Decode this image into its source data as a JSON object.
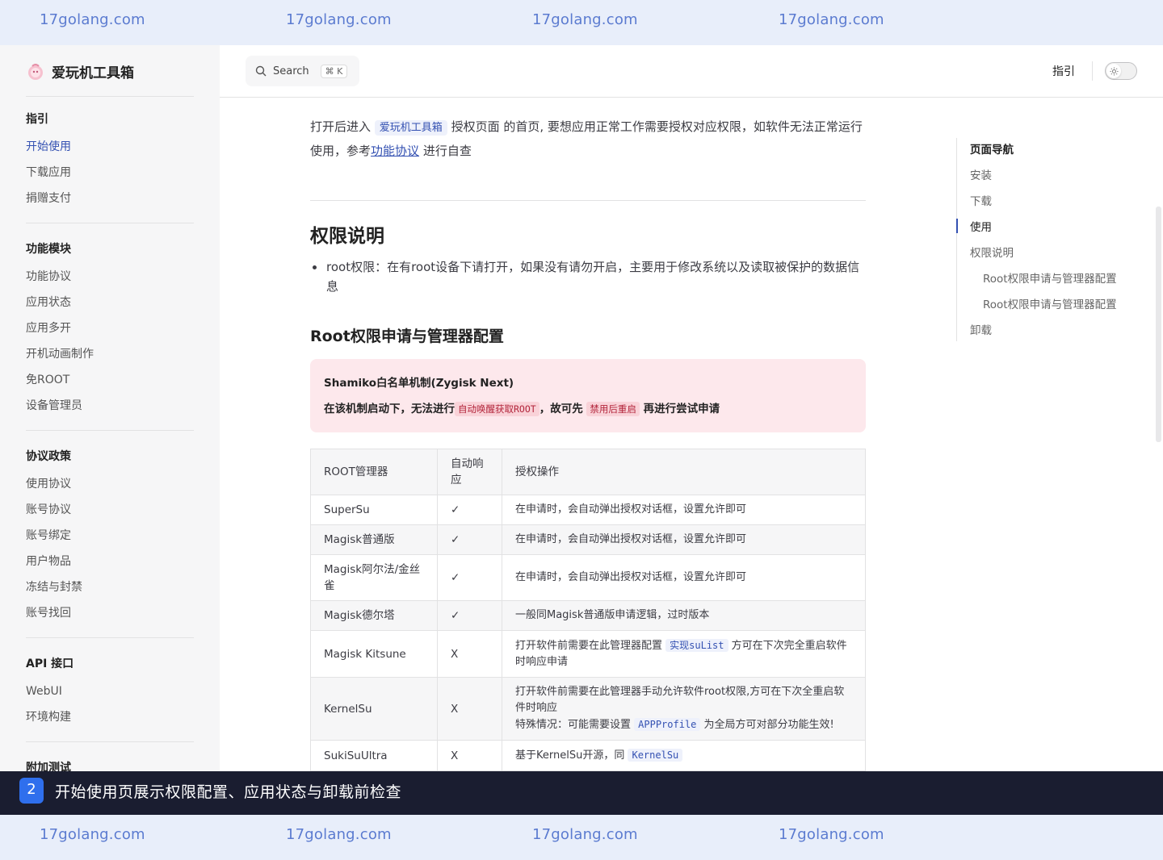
{
  "watermark": {
    "text": "17golang.com",
    "color": "#5b7bd0"
  },
  "sidebar": {
    "brand": "爱玩机工具箱",
    "groups": [
      {
        "title": "指引",
        "items": [
          "开始使用",
          "下载应用",
          "捐赠支付"
        ]
      },
      {
        "title": "功能模块",
        "items": [
          "功能协议",
          "应用状态",
          "应用多开",
          "开机动画制作",
          "免ROOT",
          "设备管理员"
        ]
      },
      {
        "title": "协议政策",
        "items": [
          "使用协议",
          "账号协议",
          "账号绑定",
          "用户物品",
          "冻结与封禁",
          "账号找回"
        ]
      },
      {
        "title": "API 接口",
        "items": [
          "WebUI",
          "环境构建"
        ]
      },
      {
        "title": "附加测试",
        "items": []
      }
    ],
    "active_item": "开始使用"
  },
  "topbar": {
    "search_label": "Search",
    "search_shortcut": "⌘ K",
    "nav_link": "指引",
    "theme_toggle_icon": "sun-icon"
  },
  "content": {
    "intro_pre": "打开后进入",
    "intro_tag": "爱玩机工具箱",
    "intro_mid": "授权页面 的首页, 要想应用正常工作需要授权对应权限，如软件无法正常运行使用，参考",
    "intro_link": "功能协议",
    "intro_post": "进行自查",
    "h2": "权限说明",
    "bullet": "root权限：在有root设备下请打开，如果没有请勿开启，主要用于修改系统以及读取被保护的数据信息",
    "h3": "Root权限申请与管理器配置",
    "danger": {
      "title": "Shamiko白名单机制(Zygisk Next)",
      "text_pre": "在该机制启动下，无法进行",
      "tag1": "自动唤醒获取ROOT",
      "text_mid": "，故可先",
      "tag2": "禁用后重启",
      "text_post": "再进行尝试申请"
    },
    "table": {
      "headers": [
        "ROOT管理器",
        "自动响应",
        "授权操作"
      ],
      "rows": [
        {
          "manager": "SuperSu",
          "auto": "✓",
          "op_pre": "在申请时，会自动弹出授权对话框，设置允许即可"
        },
        {
          "manager": "Magisk普通版",
          "auto": "✓",
          "op_pre": "在申请时，会自动弹出授权对话框，设置允许即可"
        },
        {
          "manager": "Magisk阿尔法/金丝雀",
          "auto": "✓",
          "op_pre": "在申请时，会自动弹出授权对话框，设置允许即可"
        },
        {
          "manager": "Magisk德尔塔",
          "auto": "✓",
          "op_pre": "一般同Magisk普通版申请逻辑，过时版本"
        },
        {
          "manager": "Magisk Kitsune",
          "auto": "X",
          "op_pre": "打开软件前需要在此管理器配置",
          "op_code": "实现suList",
          "op_post": "方可在下次完全重启软件时响应申请"
        },
        {
          "manager": "KernelSu",
          "auto": "X",
          "op_pre": "打开软件前需要在此管理器手动允许软件root权限,方可在下次全重启软件时响应",
          "op_line2_pre": "特殊情况：可能需要设置",
          "op_code": "APPProfile",
          "op_post": "为全局方可对部分功能生效!"
        },
        {
          "manager": "SukiSuUltra",
          "auto": "X",
          "op_pre": "基于KernelSu开源，同",
          "op_code": "KernelSu"
        }
      ]
    }
  },
  "toc": {
    "title": "页面导航",
    "items": [
      "安装",
      "下载",
      "使用",
      "权限说明",
      "Root权限申请与管理器配置",
      "Root权限申请与管理器配置",
      "卸载"
    ],
    "active_item": "使用"
  },
  "caption": {
    "badge": "2",
    "text": "开始使用页展示权限配置、应用状态与卸载前检查"
  },
  "colors": {
    "accent": "#3451b2",
    "danger_bg": "#fde8ec",
    "danger_tag": "#b3263c",
    "caption_bg": "#1a1d30",
    "badge_bg": "#2f6fed"
  }
}
